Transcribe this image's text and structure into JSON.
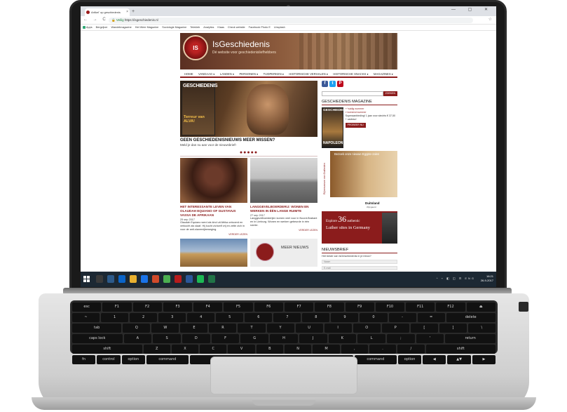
{
  "browser": {
    "tab_title": "Artikel' op geschiedenis",
    "tab_close": "×",
    "new_tab": "+",
    "window_controls": "— ▢ ✕",
    "nav": "← → C",
    "url_secure": "Veilig",
    "url": "https://isgeschiedenis.nl",
    "star": "☆",
    "bookmarks": [
      "Apps",
      "Bergvijver",
      "Wandelmagazine",
      "Het Weer Magazine",
      "Sociologie Magazine",
      "Telekleb",
      "Analytics",
      "Klaas",
      "Check website",
      "Facebook Photo E",
      "Unsplash"
    ]
  },
  "site": {
    "logo": "IS",
    "title": "IsGeschiedenis",
    "subtitle": "Dé website voor geschiedenisliefhebbers",
    "menu": [
      "HOME",
      "VANDAAG ▾",
      "LANDEN ▾",
      "PERSONEN ▾",
      "TIJDPERKEN ▾",
      "HISTORISCHE VERHALEN ▾",
      "HISTORISCHE SNACKS ▾",
      "MAGAZINES ▾"
    ]
  },
  "hero": {
    "mag_title": "GESCHIEDENIS",
    "mag_tag": "Terreur van ALVA!",
    "title": "GEEN GESCHIEDENISNIEUWS MEER MISSEN?",
    "subtitle": "Meld je dan nu aan voor de nieuwsbrief!"
  },
  "carousel_dots": "●●●●●",
  "cards": [
    {
      "title": "HET INTERESSANTE LEVEN VAN OLAUDAH EQUIANO OF GUSTAVUS VASSA DE AFRIKAAN",
      "date": "29 sep 2017",
      "text": "Olaudah Equiano werd als kind uit Afrika ontvoerd en verkocht als slaaf. Hij kocht zichzelf vrij en zette zich in voor de anti-slavernijbeweging.",
      "more": "VERDER LEZEN"
    },
    {
      "title": "LANGGEVELBOERDERIJ: WONEN EN WERKEN IN ÉÉN LANGE RUIMTE",
      "date": "27 sep 2017",
      "text": "Langgevelboerderijen komen veel voor in Noord-Brabant en in Limburg. Wonen en werken gebeurde in één ruimte.",
      "more": "VERDER LEZEN"
    }
  ],
  "more_news": "MEER NIEUWS",
  "sidebar": {
    "social": [
      "f",
      "t",
      "P"
    ],
    "search_button": "ZOEKEN",
    "magazine_heading": "GESCHIEDENIS MAGAZINE",
    "mag_cover_title": "GESCHIEDENIS",
    "mag_cover_bottom": "NAPOLEON",
    "mag_links": [
      "» huidig nummer",
      "» komend nummer"
    ],
    "mag_offer": "Superaanbieding! 1 jaar voor slechts € 37,50 + cadeau!",
    "mag_button": "PROBEER NU",
    "ad1_vertical": "Rijksmuseum van Oudheden",
    "ad1_text": "Bezoek onze nieuwe Egypte-zalen",
    "ad2_logo": "Duitsland",
    "ad2_logo_sub": "Wijngaard",
    "ad2_line1": "Explore",
    "ad2_num": "36",
    "ad2_line1b": "authentic",
    "ad2_line2": "Luther sites in Germany",
    "newsletter_heading": "NIEUWSBRIEF",
    "newsletter_text": "Het beste van IsGeschiedenis in je inbox?",
    "newsletter_fields": [
      "Naam",
      "E-mail"
    ]
  },
  "taskbar": {
    "tray": "^ ⌁ ◧ ◫ ⊟ ENG",
    "time": "16:21",
    "date": "26-9-2017"
  },
  "keyboard": {
    "rows": [
      [
        "esc",
        "F1",
        "F2",
        "F3",
        "F4",
        "F5",
        "F6",
        "F7",
        "F8",
        "F9",
        "F10",
        "F11",
        "F12",
        "⏏"
      ],
      [
        "~",
        "1",
        "2",
        "3",
        "4",
        "5",
        "6",
        "7",
        "8",
        "9",
        "0",
        "-",
        "=",
        "delete"
      ],
      [
        "tab",
        "Q",
        "W",
        "E",
        "R",
        "T",
        "Y",
        "U",
        "I",
        "O",
        "P",
        "[",
        "]",
        "\\"
      ],
      [
        "caps lock",
        "A",
        "S",
        "D",
        "F",
        "G",
        "H",
        "J",
        "K",
        "L",
        ";",
        "'",
        "return"
      ],
      [
        "shift",
        "Z",
        "X",
        "C",
        "V",
        "B",
        "N",
        "M",
        ",",
        ".",
        "/",
        "shift"
      ],
      [
        "fn",
        "control",
        "option",
        "command",
        "",
        "command",
        "option",
        "◀",
        "▲▼",
        "▶"
      ]
    ]
  }
}
